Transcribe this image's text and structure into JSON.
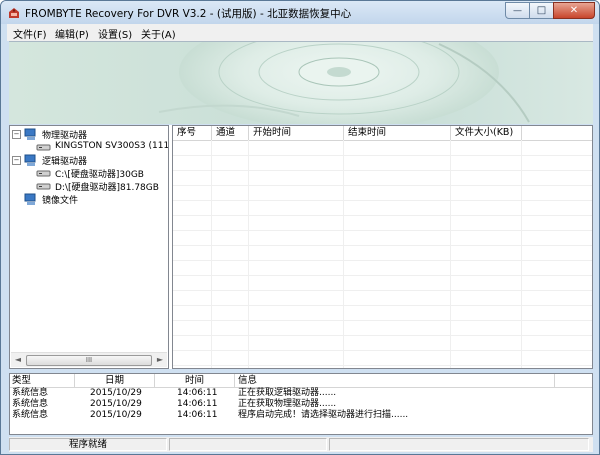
{
  "window": {
    "title": "FROMBYTE Recovery For DVR V3.2 - (试用版) - 北亚数据恢复中心",
    "min_glyph": "—",
    "max_glyph": "□",
    "close_glyph": "✕"
  },
  "menu": [
    {
      "label": "文件(F)"
    },
    {
      "label": "编辑(P)"
    },
    {
      "label": "设置(S)"
    },
    {
      "label": "关于(A)"
    }
  ],
  "tree": {
    "nodes": [
      {
        "label": "物理驱动器",
        "expander": "−",
        "icon": "computer-icon"
      },
      {
        "label": "KINGSTON SV300S3 (111.7",
        "icon": "hard-drive-icon"
      },
      {
        "label": "逻辑驱动器",
        "expander": "−",
        "icon": "computer-icon"
      },
      {
        "label": "C:\\[硬盘驱动器]30GB",
        "icon": "hard-drive-icon"
      },
      {
        "label": "D:\\[硬盘驱动器]81.78GB",
        "icon": "hard-drive-icon"
      },
      {
        "label": "镜像文件",
        "icon": "computer-icon"
      }
    ],
    "scroll_left": "◄",
    "scroll_right": "►",
    "thumb_grip": "III"
  },
  "grid": {
    "columns": [
      "序号",
      "通道",
      "开始时间",
      "结束时间",
      "文件大小(KB)"
    ],
    "rows": []
  },
  "log": {
    "columns": [
      "类型",
      "日期",
      "时间",
      "信息"
    ],
    "rows": [
      {
        "type": "系统信息",
        "date": "2015/10/29",
        "time": "14:06:11",
        "message": "正在获取逻辑驱动器......"
      },
      {
        "type": "系统信息",
        "date": "2015/10/29",
        "time": "14:06:11",
        "message": "正在获取物理驱动器......"
      },
      {
        "type": "系统信息",
        "date": "2015/10/29",
        "time": "14:06:11",
        "message": "程序启动完成！请选择驱动器进行扫描......"
      }
    ]
  },
  "status": {
    "text": "程序就绪"
  }
}
